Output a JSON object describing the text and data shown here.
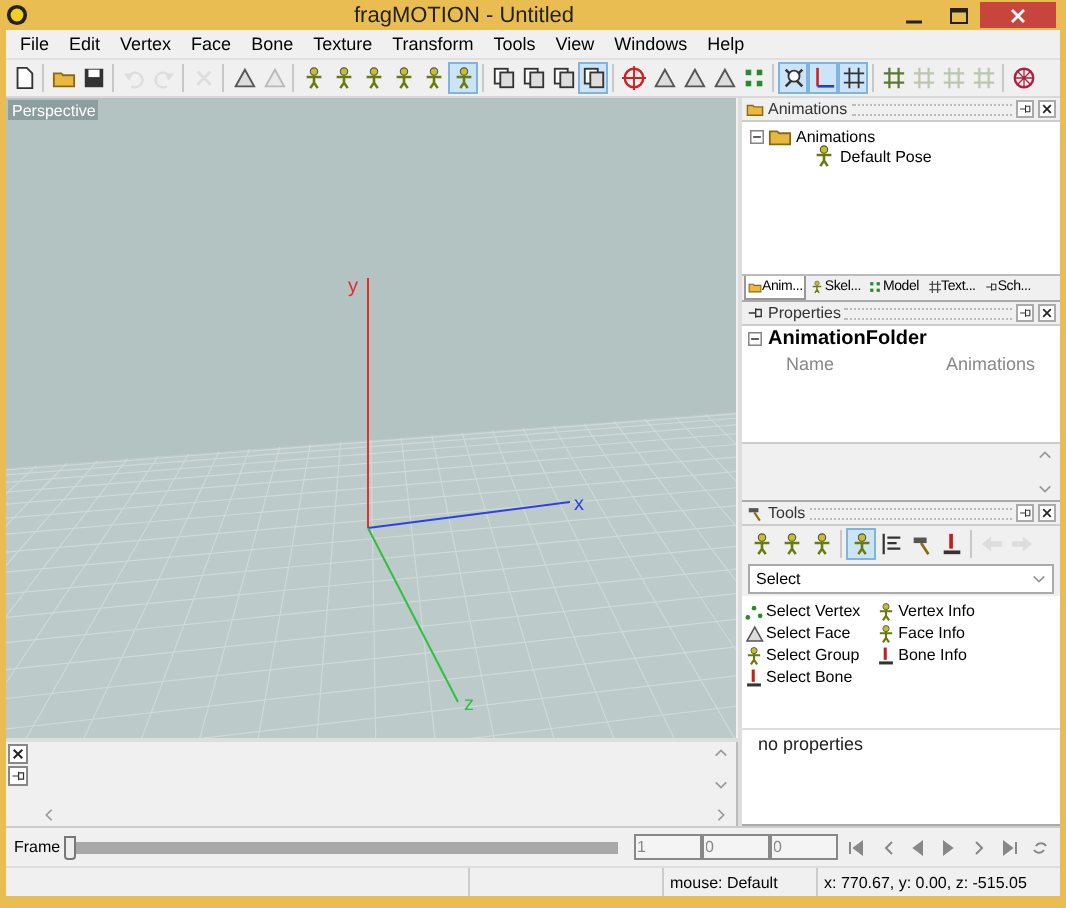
{
  "window": {
    "title": "fragMOTION - Untitled"
  },
  "menu": [
    "File",
    "Edit",
    "Vertex",
    "Face",
    "Bone",
    "Texture",
    "Transform",
    "Tools",
    "View",
    "Windows",
    "Help"
  ],
  "toolbar": [
    {
      "kind": "button",
      "pressed": false,
      "disabled": false
    },
    {
      "kind": "separator"
    },
    {
      "kind": "button",
      "pressed": false,
      "disabled": false
    },
    {
      "kind": "button",
      "pressed": false,
      "disabled": false
    },
    {
      "kind": "separator"
    },
    {
      "kind": "button",
      "pressed": false,
      "disabled": true
    },
    {
      "kind": "button",
      "pressed": false,
      "disabled": true
    },
    {
      "kind": "separator"
    },
    {
      "kind": "button",
      "pressed": false,
      "disabled": true
    },
    {
      "kind": "separator"
    },
    {
      "kind": "button",
      "pressed": false,
      "disabled": false
    },
    {
      "kind": "button",
      "pressed": false,
      "disabled": true
    },
    {
      "kind": "separator"
    },
    {
      "kind": "button",
      "pressed": false,
      "disabled": false
    },
    {
      "kind": "button",
      "pressed": false,
      "disabled": false
    },
    {
      "kind": "button",
      "pressed": false,
      "disabled": false
    },
    {
      "kind": "button",
      "pressed": false,
      "disabled": false
    },
    {
      "kind": "button",
      "pressed": false,
      "disabled": false
    },
    {
      "kind": "button",
      "pressed": true,
      "disabled": false
    },
    {
      "kind": "separator"
    },
    {
      "kind": "button",
      "pressed": false,
      "disabled": false
    },
    {
      "kind": "button",
      "pressed": false,
      "disabled": false
    },
    {
      "kind": "button",
      "pressed": false,
      "disabled": false
    },
    {
      "kind": "button",
      "pressed": true,
      "disabled": false
    },
    {
      "kind": "separator"
    },
    {
      "kind": "button",
      "pressed": false,
      "disabled": false
    },
    {
      "kind": "button",
      "pressed": false,
      "disabled": false
    },
    {
      "kind": "button",
      "pressed": false,
      "disabled": false
    },
    {
      "kind": "button",
      "pressed": false,
      "disabled": false
    },
    {
      "kind": "button",
      "pressed": false,
      "disabled": false
    },
    {
      "kind": "separator"
    },
    {
      "kind": "button",
      "pressed": true,
      "disabled": false
    },
    {
      "kind": "button",
      "pressed": true,
      "disabled": false
    },
    {
      "kind": "button",
      "pressed": true,
      "disabled": false
    },
    {
      "kind": "separator"
    },
    {
      "kind": "button",
      "pressed": false,
      "disabled": false
    },
    {
      "kind": "button",
      "pressed": false,
      "disabled": true
    },
    {
      "kind": "button",
      "pressed": false,
      "disabled": true
    },
    {
      "kind": "button",
      "pressed": false,
      "disabled": true
    },
    {
      "kind": "separator"
    },
    {
      "kind": "button",
      "pressed": false,
      "disabled": false
    }
  ],
  "viewport": {
    "label": "Perspective",
    "axes": [
      {
        "label": "y",
        "color": "#e03030"
      },
      {
        "label": "x",
        "color": "#3040e0"
      },
      {
        "label": "z",
        "color": "#30c040"
      }
    ]
  },
  "animations_panel": {
    "title": "Animations",
    "tree": [
      {
        "label": "Animations",
        "expanded": true,
        "children": [
          {
            "label": "Default Pose"
          }
        ]
      }
    ],
    "tabs": [
      {
        "label": "Anim...",
        "selected": true
      },
      {
        "label": "Skel...",
        "selected": false
      },
      {
        "label": "Model",
        "selected": false
      },
      {
        "label": "Text...",
        "selected": false
      },
      {
        "label": "Sch...",
        "selected": false
      }
    ]
  },
  "properties_panel": {
    "title": "Properties",
    "category": {
      "label": "AnimationFolder",
      "expanded": true
    },
    "rows": [
      {
        "name": "Name",
        "value": "Animations"
      }
    ]
  },
  "tools_panel": {
    "title": "Tools",
    "toolbar": [
      {
        "kind": "button",
        "pressed": false,
        "disabled": false
      },
      {
        "kind": "button",
        "pressed": false,
        "disabled": false
      },
      {
        "kind": "button",
        "pressed": false,
        "disabled": false
      },
      {
        "kind": "separator"
      },
      {
        "kind": "button",
        "pressed": true,
        "disabled": false
      },
      {
        "kind": "button",
        "pressed": false,
        "disabled": false
      },
      {
        "kind": "button",
        "pressed": false,
        "disabled": false
      },
      {
        "kind": "button",
        "pressed": false,
        "disabled": false
      },
      {
        "kind": "separator"
      },
      {
        "kind": "button",
        "pressed": false,
        "disabled": true
      },
      {
        "kind": "button",
        "pressed": false,
        "disabled": true
      }
    ],
    "dropdown": {
      "value": "Select"
    },
    "columns": [
      [
        {
          "label": "Select Vertex"
        },
        {
          "label": "Select Face"
        },
        {
          "label": "Select Group"
        },
        {
          "label": "Select Bone"
        }
      ],
      [
        {
          "label": "Vertex Info"
        },
        {
          "label": "Face Info"
        },
        {
          "label": "Bone Info"
        }
      ]
    ],
    "properties": "no properties"
  },
  "frame_bar": {
    "label": "Frame",
    "slider": {
      "level": 0
    },
    "fields": [
      "1",
      "0",
      "0"
    ]
  },
  "status_bar": [
    "mouse: Default",
    "x: 770.67, y: 0.00, z: -515.05"
  ]
}
